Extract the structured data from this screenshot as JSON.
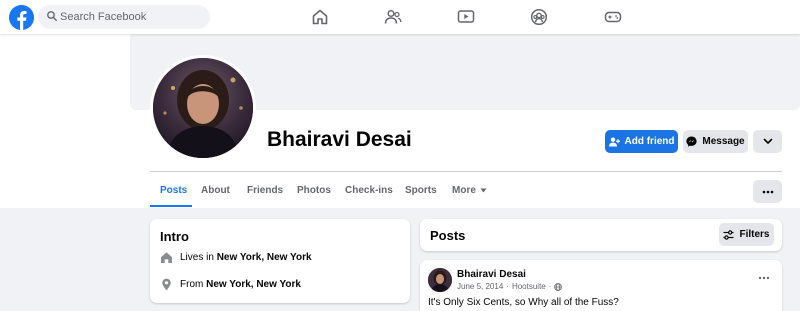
{
  "search": {
    "placeholder": "Search Facebook"
  },
  "nav": {
    "icons": [
      "home-icon",
      "friends-icon",
      "watch-icon",
      "groups-icon",
      "gaming-icon"
    ]
  },
  "profile": {
    "name": "Bhairavi Desai",
    "add_friend_label": "Add friend",
    "message_label": "Message"
  },
  "tabs": [
    {
      "label": "Posts"
    },
    {
      "label": "About"
    },
    {
      "label": "Friends"
    },
    {
      "label": "Photos"
    },
    {
      "label": "Check-ins"
    },
    {
      "label": "Sports"
    },
    {
      "label": "More"
    }
  ],
  "intro": {
    "title": "Intro",
    "lives_prefix": "Lives in",
    "lives_value": "New York, New York",
    "from_prefix": "From",
    "from_value": "New York, New York"
  },
  "posts": {
    "title": "Posts",
    "filters_label": "Filters",
    "items": [
      {
        "author": "Bhairavi Desai",
        "date": "June 5, 2014",
        "separator": "·",
        "source": "Hootsuite",
        "dot": "·",
        "text": "It's Only Six Cents, so Why all of the Fuss?"
      }
    ]
  },
  "colors": {
    "brand": "#1877f2",
    "primary_button": "#1b74e4",
    "page_bg": "#f0f2f5"
  }
}
